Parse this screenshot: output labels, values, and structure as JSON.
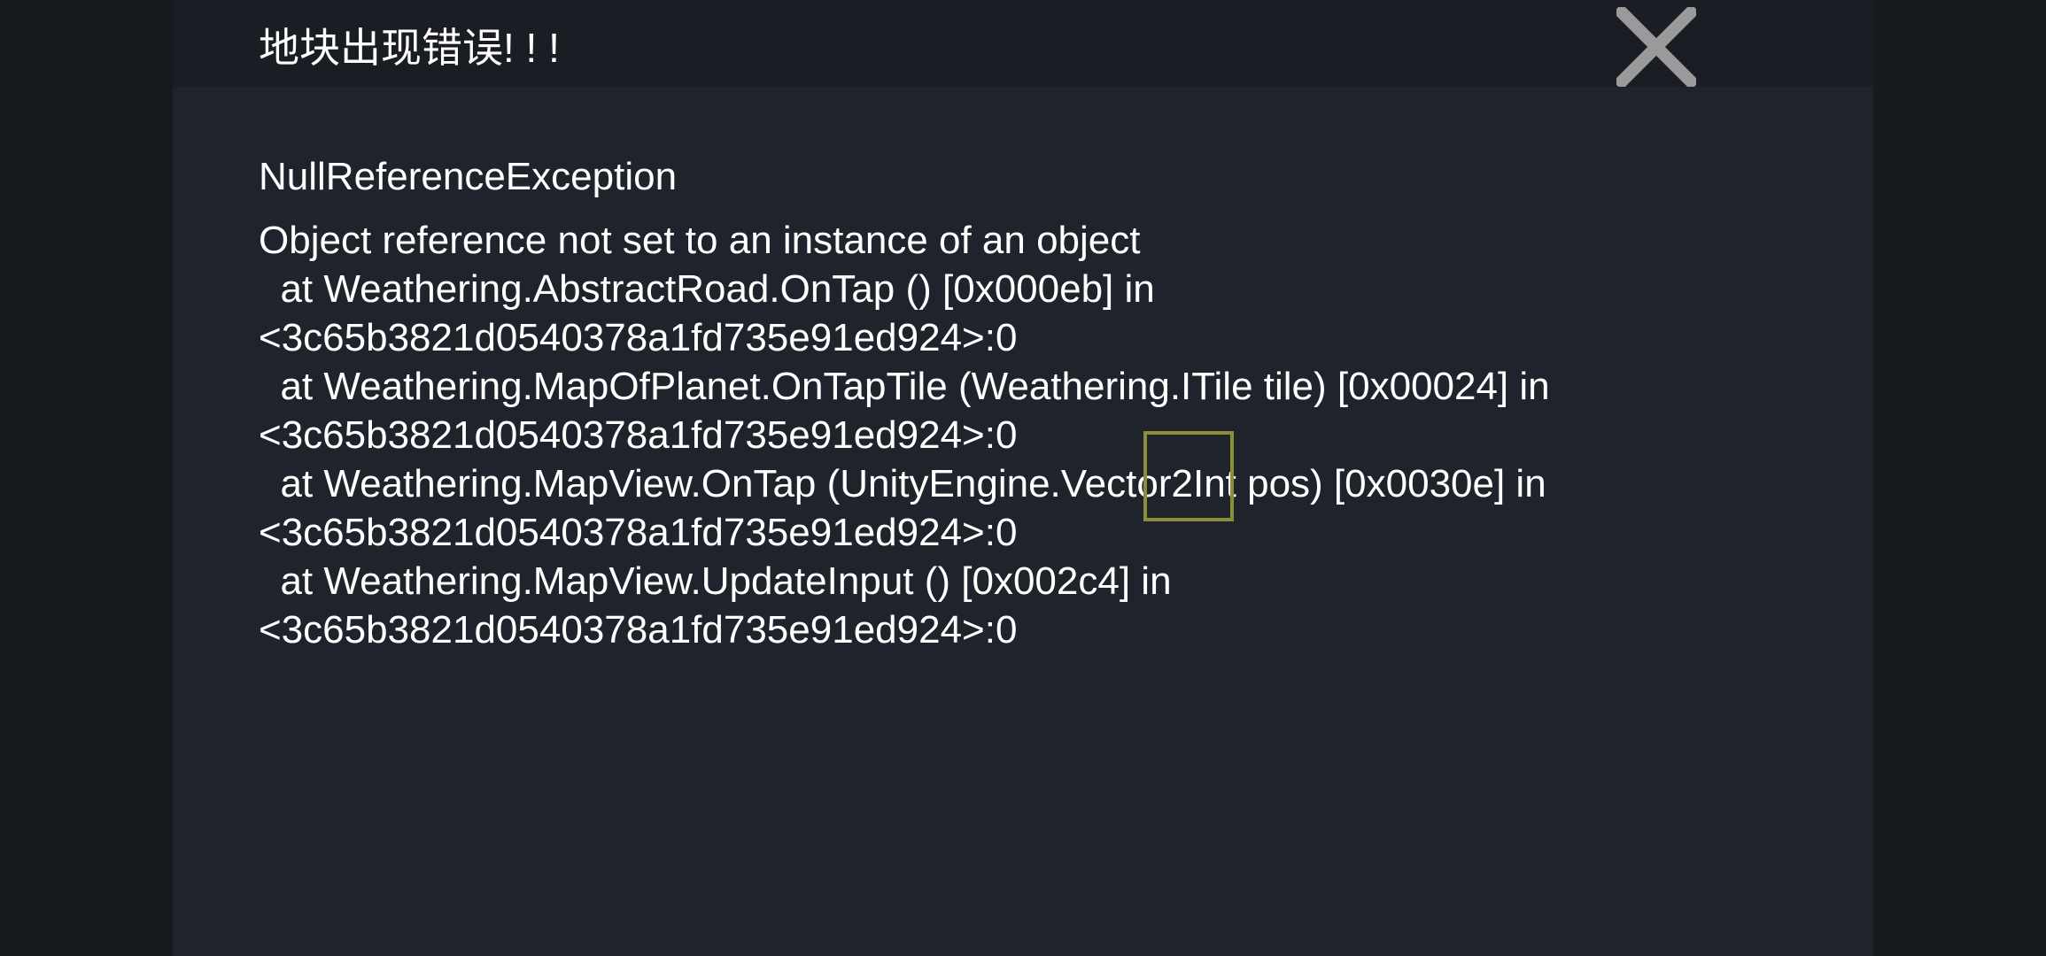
{
  "dialog": {
    "title": "地块出现错误! ! !",
    "close_icon": "close-x-icon",
    "exception_type": "NullReferenceException",
    "stack_trace": [
      "Object reference not set to an instance of an object",
      "  at Weathering.AbstractRoad.OnTap () [0x000eb] in",
      "<3c65b3821d0540378a1fd735e91ed924>:0",
      "  at Weathering.MapOfPlanet.OnTapTile (Weathering.ITile tile) [0x00024] in",
      "<3c65b3821d0540378a1fd735e91ed924>:0",
      "  at Weathering.MapView.OnTap (UnityEngine.Vector2Int pos) [0x0030e] in",
      "<3c65b3821d0540378a1fd735e91ed924>:0",
      "  at Weathering.MapView.UpdateInput () [0x002c4] in",
      "<3c65b3821d0540378a1fd735e91ed924>:0"
    ]
  },
  "colors": {
    "background": "#16191e",
    "dialog_body": "#1f232b",
    "dialog_header": "#1a1d23",
    "text": "#ffffff",
    "close_icon": "#9a9a9a",
    "tile_cursor": "#8a8d3a"
  }
}
